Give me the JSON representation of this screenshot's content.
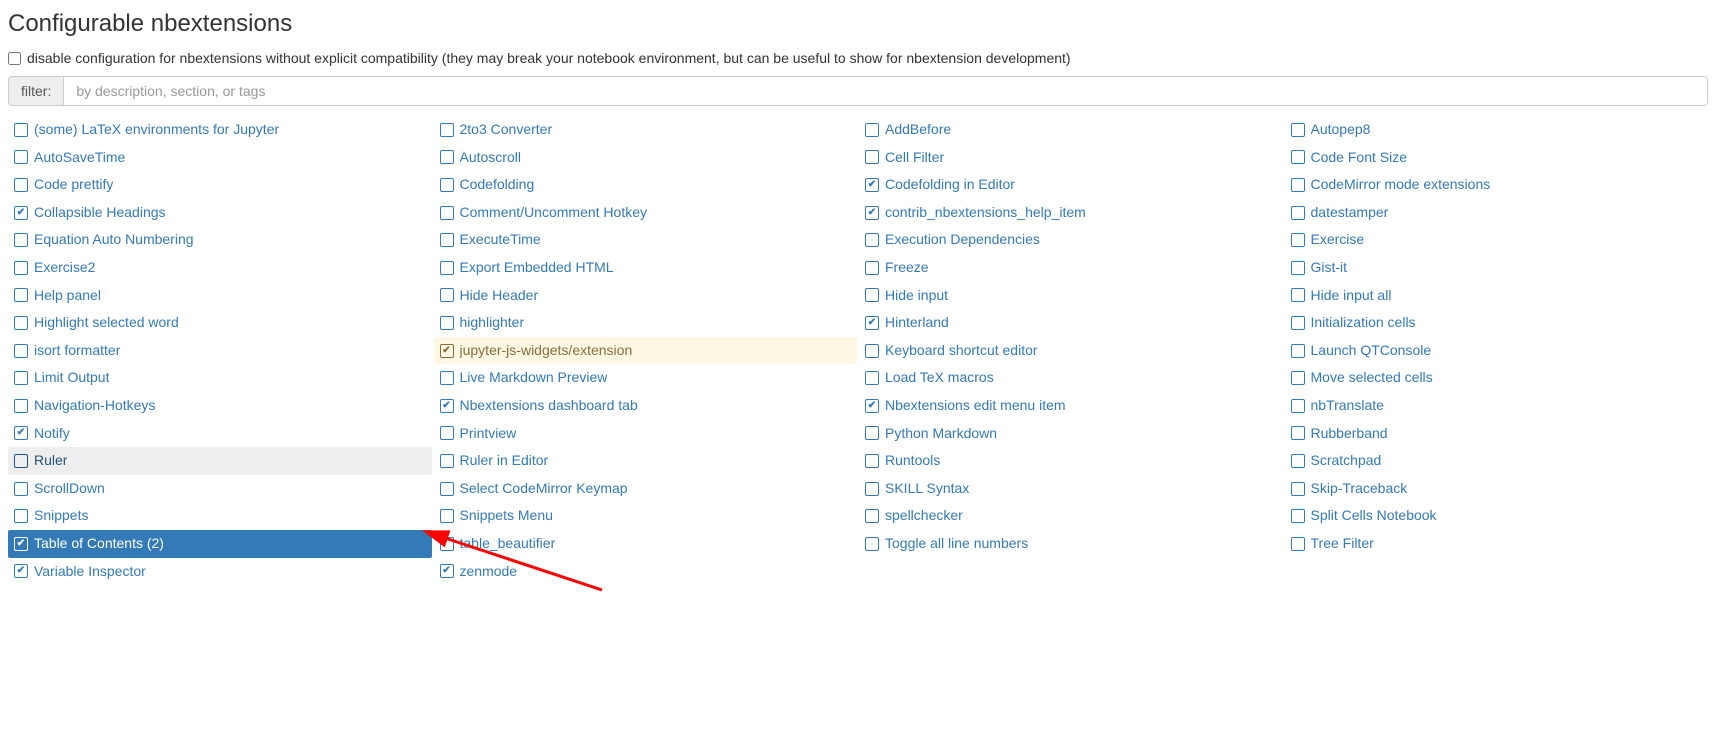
{
  "title": "Configurable nbextensions",
  "compat_checkbox_label": "disable configuration for nbextensions without explicit compatibility (they may break your notebook environment, but can be useful to show for nbextension development)",
  "compat_checked": false,
  "filter": {
    "label": "filter:",
    "placeholder": "by description, section, or tags",
    "value": ""
  },
  "extensions": [
    {
      "label": "(some) LaTeX environments for Jupyter",
      "checked": false
    },
    {
      "label": "2to3 Converter",
      "checked": false
    },
    {
      "label": "AddBefore",
      "checked": false
    },
    {
      "label": "Autopep8",
      "checked": false
    },
    {
      "label": "AutoSaveTime",
      "checked": false
    },
    {
      "label": "Autoscroll",
      "checked": false
    },
    {
      "label": "Cell Filter",
      "checked": false
    },
    {
      "label": "Code Font Size",
      "checked": false
    },
    {
      "label": "Code prettify",
      "checked": false
    },
    {
      "label": "Codefolding",
      "checked": false
    },
    {
      "label": "Codefolding in Editor",
      "checked": true
    },
    {
      "label": "CodeMirror mode extensions",
      "checked": false
    },
    {
      "label": "Collapsible Headings",
      "checked": true
    },
    {
      "label": "Comment/Uncomment Hotkey",
      "checked": false
    },
    {
      "label": "contrib_nbextensions_help_item",
      "checked": true
    },
    {
      "label": "datestamper",
      "checked": false
    },
    {
      "label": "Equation Auto Numbering",
      "checked": false
    },
    {
      "label": "ExecuteTime",
      "checked": false
    },
    {
      "label": "Execution Dependencies",
      "checked": false
    },
    {
      "label": "Exercise",
      "checked": false
    },
    {
      "label": "Exercise2",
      "checked": false
    },
    {
      "label": "Export Embedded HTML",
      "checked": false
    },
    {
      "label": "Freeze",
      "checked": false
    },
    {
      "label": "Gist-it",
      "checked": false
    },
    {
      "label": "Help panel",
      "checked": false
    },
    {
      "label": "Hide Header",
      "checked": false
    },
    {
      "label": "Hide input",
      "checked": false
    },
    {
      "label": "Hide input all",
      "checked": false
    },
    {
      "label": "Highlight selected word",
      "checked": false
    },
    {
      "label": "highlighter",
      "checked": false
    },
    {
      "label": "Hinterland",
      "checked": true
    },
    {
      "label": "Initialization cells",
      "checked": false
    },
    {
      "label": "isort formatter",
      "checked": false
    },
    {
      "label": "jupyter-js-widgets/extension",
      "checked": true,
      "highlighted": true
    },
    {
      "label": "Keyboard shortcut editor",
      "checked": false
    },
    {
      "label": "Launch QTConsole",
      "checked": false
    },
    {
      "label": "Limit Output",
      "checked": false
    },
    {
      "label": "Live Markdown Preview",
      "checked": false
    },
    {
      "label": "Load TeX macros",
      "checked": false
    },
    {
      "label": "Move selected cells",
      "checked": false
    },
    {
      "label": "Navigation-Hotkeys",
      "checked": false
    },
    {
      "label": "Nbextensions dashboard tab",
      "checked": true
    },
    {
      "label": "Nbextensions edit menu item",
      "checked": true
    },
    {
      "label": "nbTranslate",
      "checked": false
    },
    {
      "label": "Notify",
      "checked": true
    },
    {
      "label": "Printview",
      "checked": false
    },
    {
      "label": "Python Markdown",
      "checked": false
    },
    {
      "label": "Rubberband",
      "checked": false
    },
    {
      "label": "Ruler",
      "checked": false,
      "hovered": true
    },
    {
      "label": "Ruler in Editor",
      "checked": false
    },
    {
      "label": "Runtools",
      "checked": false
    },
    {
      "label": "Scratchpad",
      "checked": false
    },
    {
      "label": "ScrollDown",
      "checked": false
    },
    {
      "label": "Select CodeMirror Keymap",
      "checked": false
    },
    {
      "label": "SKILL Syntax",
      "checked": false
    },
    {
      "label": "Skip-Traceback",
      "checked": false
    },
    {
      "label": "Snippets",
      "checked": false
    },
    {
      "label": "Snippets Menu",
      "checked": false
    },
    {
      "label": "spellchecker",
      "checked": false
    },
    {
      "label": "Split Cells Notebook",
      "checked": false
    },
    {
      "label": "Table of Contents (2)",
      "checked": true,
      "selected": true
    },
    {
      "label": "table_beautifier",
      "checked": false
    },
    {
      "label": "Toggle all line numbers",
      "checked": false
    },
    {
      "label": "Tree Filter",
      "checked": false
    },
    {
      "label": "Variable Inspector",
      "checked": true
    },
    {
      "label": "zenmode",
      "checked": true
    }
  ]
}
